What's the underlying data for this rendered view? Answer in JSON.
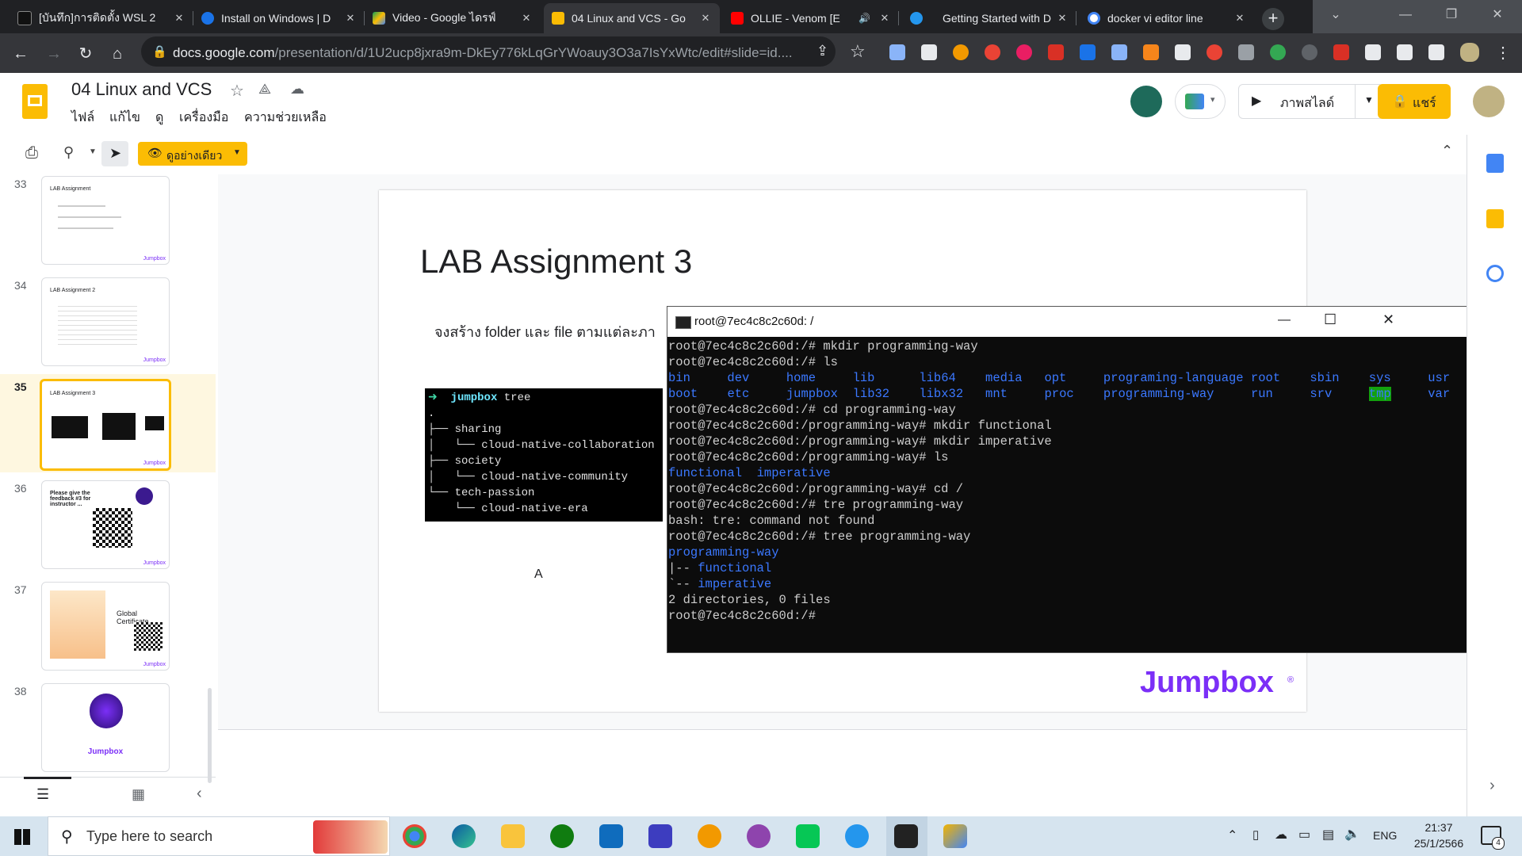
{
  "browser": {
    "tabs": [
      {
        "title": "[บันทึก]การติดตั้ง WSL 2",
        "color": "#e8eaed"
      },
      {
        "title": "Install on Windows | D",
        "color": "#1a73e8"
      },
      {
        "title": "Video - Google ไดรฟ์",
        "color": "#fbbc04"
      },
      {
        "title": "04 Linux and VCS - Go",
        "color": "#fbbc04"
      },
      {
        "title": "OLLIE - Venom [E",
        "color": "#ff0000"
      },
      {
        "title": "Getting Started with D",
        "color": "#2496ed"
      },
      {
        "title": "docker vi editor line",
        "color": "#e8eaed"
      }
    ],
    "new_tab": "+",
    "url_host": "docs.google.com",
    "url_path": "/presentation/d/1U2ucp8jxra9m-DkEy776kLqGrYWoauy3O3a7IsYxWtc/edit#slide=id...."
  },
  "slides_app": {
    "doc_title": "04 Linux and VCS",
    "menus": [
      "ไฟล์",
      "แก้ไข",
      "ดู",
      "เครื่องมือ",
      "ความช่วยเหลือ"
    ],
    "present_label": "ภาพสไลด์",
    "share_label": "แชร์",
    "view_mode_label": "ดูอย่างเดียว",
    "filmstrip": [
      {
        "num": "33",
        "title": "LAB Assignment",
        "footer": "Jumpbox"
      },
      {
        "num": "34",
        "title": "LAB Assignment 2",
        "footer": "Jumpbox"
      },
      {
        "num": "35",
        "title": "LAB Assignment 3",
        "footer": "Jumpbox"
      },
      {
        "num": "36",
        "title": "Please give the feedback #3 for instructor ...",
        "footer": "Jumpbox"
      },
      {
        "num": "37",
        "title": "Global Certificate",
        "footer": "Jumpbox"
      },
      {
        "num": "38",
        "title": "Jumpbox",
        "footer": ""
      }
    ],
    "slide": {
      "title": "LAB Assignment 3",
      "instruction": "จงสร้าง folder และ file ตามแต่ละภา",
      "tree_prompt": "jumpbox",
      "tree_cmd": "tree",
      "tree_lines": [
        ".",
        "├── sharing",
        "│   └── cloud-native-collaboration",
        "├── society",
        "│   └── cloud-native-community",
        "└── tech-passion",
        "    └── cloud-native-era"
      ],
      "caption": "A",
      "brand": "Jumpbox"
    }
  },
  "terminal": {
    "title": "root@7ec4c8c2c60d: /",
    "lines": [
      "root@7ec4c8c2c60d:/# mkdir programming-way",
      "root@7ec4c8c2c60d:/# ls"
    ],
    "ls_row1": [
      "bin",
      "dev",
      "home",
      "lib",
      "lib64",
      "media",
      "opt",
      "programing-language",
      "root",
      "sbin",
      "sys",
      "usr"
    ],
    "ls_row2": [
      "boot",
      "etc",
      "jumpbox",
      "lib32",
      "libx32",
      "mnt",
      "proc",
      "programming-way",
      "run",
      "srv",
      "tmp",
      "var"
    ],
    "lines2": [
      "root@7ec4c8c2c60d:/# cd programming-way",
      "root@7ec4c8c2c60d:/programming-way# mkdir functional",
      "root@7ec4c8c2c60d:/programming-way# mkdir imperative",
      "root@7ec4c8c2c60d:/programming-way# ls"
    ],
    "ls_out": "functional  imperative",
    "lines3": [
      "root@7ec4c8c2c60d:/programming-way# cd /",
      "root@7ec4c8c2c60d:/# tre programming-way",
      "bash: tre: command not found",
      "root@7ec4c8c2c60d:/# tree programming-way"
    ],
    "tree_root": "programming-way",
    "tree_items": [
      "functional",
      "imperative"
    ],
    "summary": "2 directories, 0 files",
    "prompt": "root@7ec4c8c2c60d:/#"
  },
  "taskbar": {
    "search_placeholder": "Type here to search",
    "lang": "ENG",
    "time": "21:37",
    "date": "25/1/2566",
    "notifications": "4"
  }
}
